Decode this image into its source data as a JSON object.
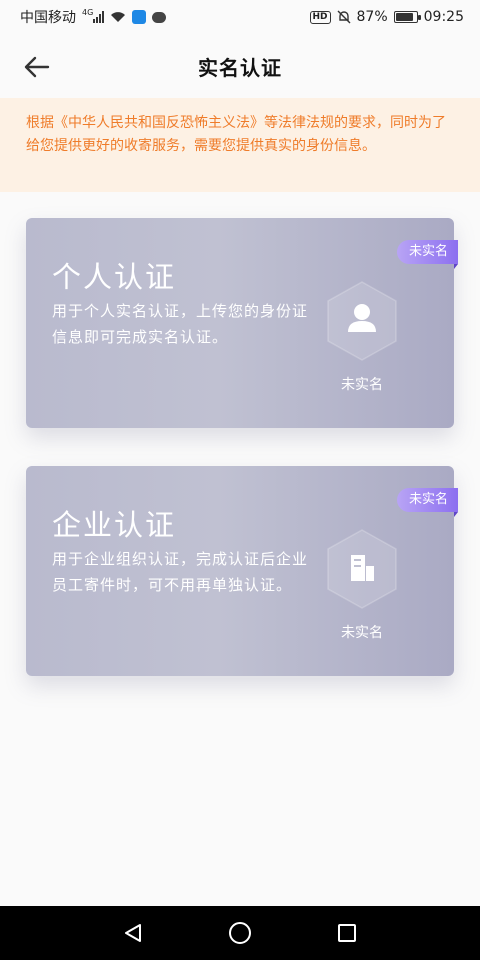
{
  "status_bar": {
    "carrier": "中国移动",
    "network": "4G",
    "battery_percent": "87%",
    "battery_level": 0.87,
    "time": "09:25",
    "icons": [
      "signal-icon",
      "wifi-icon",
      "app-notification-icon",
      "message-icon",
      "hd-icon",
      "mute-icon",
      "battery-icon"
    ]
  },
  "header": {
    "title": "实名认证",
    "back_icon": "arrow-left-icon"
  },
  "notice": {
    "text": "根据《中华人民共和国反恐怖主义法》等法律法规的要求，同时为了给您提供更好的收寄服务，需要您提供真实的身份信息。",
    "color": "#ef7c2a",
    "background": "#fdf1e4"
  },
  "cards": [
    {
      "title": "个人认证",
      "description": "用于个人实名认证，上传您的身份证信息即可完成实名认证。",
      "tag": "未实名",
      "status": "未实名",
      "icon": "person-icon"
    },
    {
      "title": "企业认证",
      "description": "用于企业组织认证，完成认证后企业员工寄件时，可不用再单独认证。",
      "tag": "未实名",
      "status": "未实名",
      "icon": "building-icon"
    }
  ],
  "nav_bar": {
    "icons": [
      "back-triangle-icon",
      "home-circle-icon",
      "recents-square-icon"
    ]
  },
  "colors": {
    "tag_gradient_start": "#b8a4f5",
    "tag_gradient_end": "#8c6ff0",
    "card_bg": "#b9bace"
  }
}
